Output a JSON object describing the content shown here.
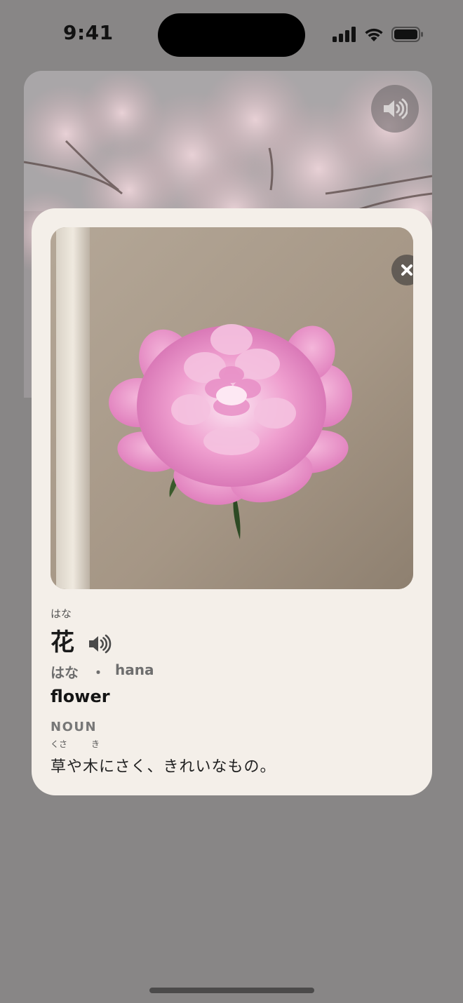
{
  "status_bar": {
    "time": "9:41",
    "icons": [
      "cellular-signal-icon",
      "wifi-icon",
      "battery-icon"
    ]
  },
  "background_card": {
    "image": "cherry-blossom-branches",
    "speaker_icon": "speaker-icon"
  },
  "word_card": {
    "image": "pink-peony-flower",
    "close_icon": "close-icon",
    "furigana": "はな",
    "word": "花",
    "speaker_icon": "speaker-icon",
    "reading_kana": "はな",
    "reading_separator": "・",
    "reading_romaji": "hana",
    "meaning": "flower",
    "part_of_speech": "NOUN",
    "definition_ruby": [
      "くさ",
      "き"
    ],
    "definition": "草や木にさく、きれいなもの。"
  },
  "colors": {
    "backdrop": "#888686",
    "sheet": "#f4efe9",
    "flower_pink": "#e98fc6"
  }
}
